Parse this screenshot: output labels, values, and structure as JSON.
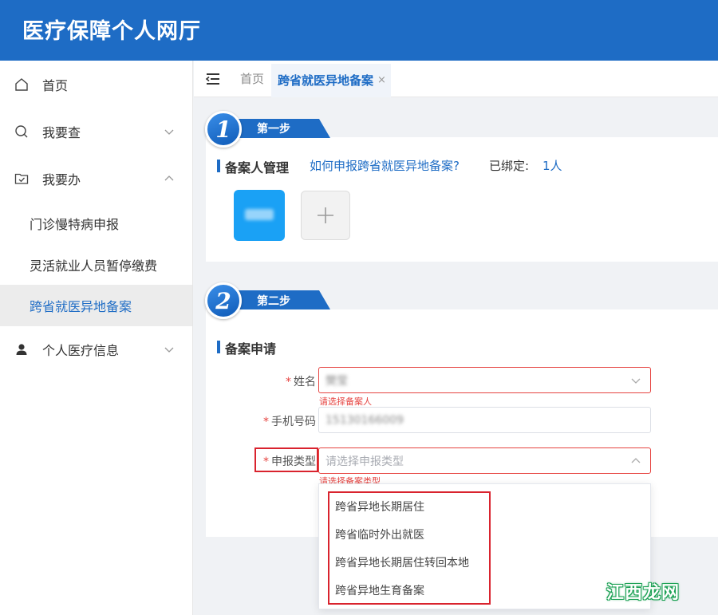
{
  "app": {
    "title": "医疗保障个人网厅"
  },
  "sidebar": {
    "items": [
      {
        "label": "首页",
        "icon": "home-icon"
      },
      {
        "label": "我要查",
        "icon": "search-icon"
      },
      {
        "label": "我要办",
        "icon": "folder-check-icon"
      },
      {
        "label": "个人医疗信息",
        "icon": "user-icon"
      }
    ],
    "subitems": [
      {
        "label": "门诊慢特病申报"
      },
      {
        "label": "灵活就业人员暂停缴费"
      },
      {
        "label": "跨省就医异地备案",
        "active": true
      }
    ]
  },
  "tabs": {
    "home": "首页",
    "active": "跨省就医异地备案",
    "close": "×"
  },
  "step1": {
    "number": "1",
    "label": "第一步",
    "section_title": "备案人管理",
    "help_link": "如何申报跨省就医异地备案?",
    "bound_label": "已绑定:",
    "bound_value": "1人",
    "add_symbol": "+"
  },
  "step2": {
    "number": "2",
    "label": "第二步",
    "section_title": "备案申请",
    "required_mark": "*",
    "fields": {
      "name": {
        "label": "姓名",
        "value": "樊莹",
        "error": "请选择备案人"
      },
      "phone": {
        "label": "手机号码",
        "value": "15130166009"
      },
      "type": {
        "label": "申报类型",
        "placeholder": "请选择申报类型",
        "error": "请选择备案类型"
      }
    },
    "options": [
      "跨省异地长期居住",
      "跨省临时外出就医",
      "跨省异地长期居住转回本地",
      "跨省异地生育备案"
    ]
  },
  "watermark": "江西龙网",
  "colors": {
    "brand": "#1e6cc5",
    "error": "#e64340",
    "highlight_frame": "#d9232e",
    "avatar_tile": "#1aa1f5"
  }
}
